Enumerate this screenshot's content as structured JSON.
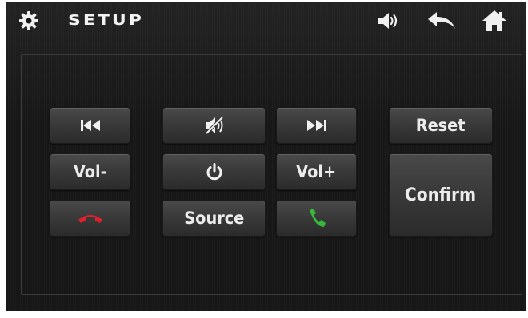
{
  "header": {
    "title": "SETUP"
  },
  "icons": {
    "gear": "gear-icon",
    "volume": "speaker-volume-icon",
    "back": "back-arrow-icon",
    "home": "home-icon"
  },
  "buttons": {
    "prev": {
      "icon": "skip-previous-icon"
    },
    "mute": {
      "icon": "mute-icon"
    },
    "next": {
      "icon": "skip-next-icon"
    },
    "reset": {
      "label": "Reset"
    },
    "vol_down": {
      "label": "Vol-"
    },
    "power": {
      "icon": "power-icon"
    },
    "vol_up": {
      "label": "Vol+"
    },
    "confirm": {
      "label": "Confirm"
    },
    "hangup": {
      "icon": "hang-up-icon",
      "color": "#e0202a"
    },
    "source": {
      "label": "Source"
    },
    "call": {
      "icon": "call-answer-icon",
      "color": "#36b83a"
    }
  },
  "colors": {
    "background": "#171717",
    "button": "#3a3a3a",
    "text": "#ececec"
  }
}
